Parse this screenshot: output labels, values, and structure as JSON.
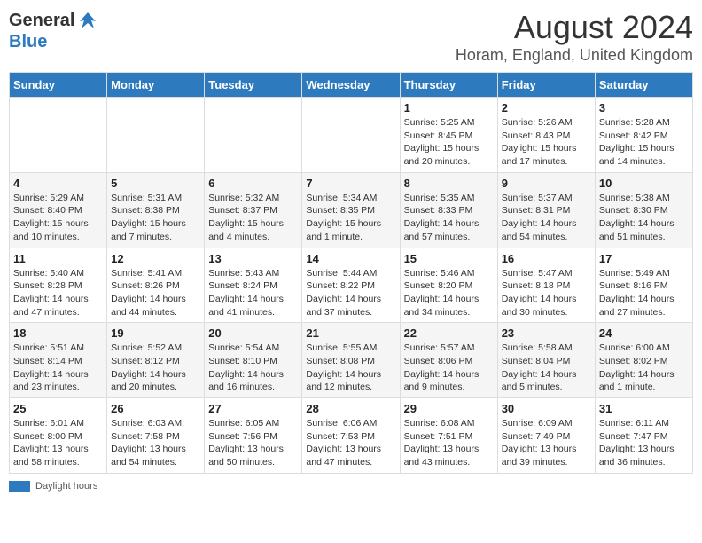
{
  "header": {
    "logo_general": "General",
    "logo_blue": "Blue",
    "title": "August 2024",
    "subtitle": "Horam, England, United Kingdom"
  },
  "days_of_week": [
    "Sunday",
    "Monday",
    "Tuesday",
    "Wednesday",
    "Thursday",
    "Friday",
    "Saturday"
  ],
  "weeks": [
    [
      {
        "day": "",
        "info": ""
      },
      {
        "day": "",
        "info": ""
      },
      {
        "day": "",
        "info": ""
      },
      {
        "day": "",
        "info": ""
      },
      {
        "day": "1",
        "info": "Sunrise: 5:25 AM\nSunset: 8:45 PM\nDaylight: 15 hours and 20 minutes."
      },
      {
        "day": "2",
        "info": "Sunrise: 5:26 AM\nSunset: 8:43 PM\nDaylight: 15 hours and 17 minutes."
      },
      {
        "day": "3",
        "info": "Sunrise: 5:28 AM\nSunset: 8:42 PM\nDaylight: 15 hours and 14 minutes."
      }
    ],
    [
      {
        "day": "4",
        "info": "Sunrise: 5:29 AM\nSunset: 8:40 PM\nDaylight: 15 hours and 10 minutes."
      },
      {
        "day": "5",
        "info": "Sunrise: 5:31 AM\nSunset: 8:38 PM\nDaylight: 15 hours and 7 minutes."
      },
      {
        "day": "6",
        "info": "Sunrise: 5:32 AM\nSunset: 8:37 PM\nDaylight: 15 hours and 4 minutes."
      },
      {
        "day": "7",
        "info": "Sunrise: 5:34 AM\nSunset: 8:35 PM\nDaylight: 15 hours and 1 minute."
      },
      {
        "day": "8",
        "info": "Sunrise: 5:35 AM\nSunset: 8:33 PM\nDaylight: 14 hours and 57 minutes."
      },
      {
        "day": "9",
        "info": "Sunrise: 5:37 AM\nSunset: 8:31 PM\nDaylight: 14 hours and 54 minutes."
      },
      {
        "day": "10",
        "info": "Sunrise: 5:38 AM\nSunset: 8:30 PM\nDaylight: 14 hours and 51 minutes."
      }
    ],
    [
      {
        "day": "11",
        "info": "Sunrise: 5:40 AM\nSunset: 8:28 PM\nDaylight: 14 hours and 47 minutes."
      },
      {
        "day": "12",
        "info": "Sunrise: 5:41 AM\nSunset: 8:26 PM\nDaylight: 14 hours and 44 minutes."
      },
      {
        "day": "13",
        "info": "Sunrise: 5:43 AM\nSunset: 8:24 PM\nDaylight: 14 hours and 41 minutes."
      },
      {
        "day": "14",
        "info": "Sunrise: 5:44 AM\nSunset: 8:22 PM\nDaylight: 14 hours and 37 minutes."
      },
      {
        "day": "15",
        "info": "Sunrise: 5:46 AM\nSunset: 8:20 PM\nDaylight: 14 hours and 34 minutes."
      },
      {
        "day": "16",
        "info": "Sunrise: 5:47 AM\nSunset: 8:18 PM\nDaylight: 14 hours and 30 minutes."
      },
      {
        "day": "17",
        "info": "Sunrise: 5:49 AM\nSunset: 8:16 PM\nDaylight: 14 hours and 27 minutes."
      }
    ],
    [
      {
        "day": "18",
        "info": "Sunrise: 5:51 AM\nSunset: 8:14 PM\nDaylight: 14 hours and 23 minutes."
      },
      {
        "day": "19",
        "info": "Sunrise: 5:52 AM\nSunset: 8:12 PM\nDaylight: 14 hours and 20 minutes."
      },
      {
        "day": "20",
        "info": "Sunrise: 5:54 AM\nSunset: 8:10 PM\nDaylight: 14 hours and 16 minutes."
      },
      {
        "day": "21",
        "info": "Sunrise: 5:55 AM\nSunset: 8:08 PM\nDaylight: 14 hours and 12 minutes."
      },
      {
        "day": "22",
        "info": "Sunrise: 5:57 AM\nSunset: 8:06 PM\nDaylight: 14 hours and 9 minutes."
      },
      {
        "day": "23",
        "info": "Sunrise: 5:58 AM\nSunset: 8:04 PM\nDaylight: 14 hours and 5 minutes."
      },
      {
        "day": "24",
        "info": "Sunrise: 6:00 AM\nSunset: 8:02 PM\nDaylight: 14 hours and 1 minute."
      }
    ],
    [
      {
        "day": "25",
        "info": "Sunrise: 6:01 AM\nSunset: 8:00 PM\nDaylight: 13 hours and 58 minutes."
      },
      {
        "day": "26",
        "info": "Sunrise: 6:03 AM\nSunset: 7:58 PM\nDaylight: 13 hours and 54 minutes."
      },
      {
        "day": "27",
        "info": "Sunrise: 6:05 AM\nSunset: 7:56 PM\nDaylight: 13 hours and 50 minutes."
      },
      {
        "day": "28",
        "info": "Sunrise: 6:06 AM\nSunset: 7:53 PM\nDaylight: 13 hours and 47 minutes."
      },
      {
        "day": "29",
        "info": "Sunrise: 6:08 AM\nSunset: 7:51 PM\nDaylight: 13 hours and 43 minutes."
      },
      {
        "day": "30",
        "info": "Sunrise: 6:09 AM\nSunset: 7:49 PM\nDaylight: 13 hours and 39 minutes."
      },
      {
        "day": "31",
        "info": "Sunrise: 6:11 AM\nSunset: 7:47 PM\nDaylight: 13 hours and 36 minutes."
      }
    ]
  ],
  "footer": {
    "legend_label": "Daylight hours"
  }
}
